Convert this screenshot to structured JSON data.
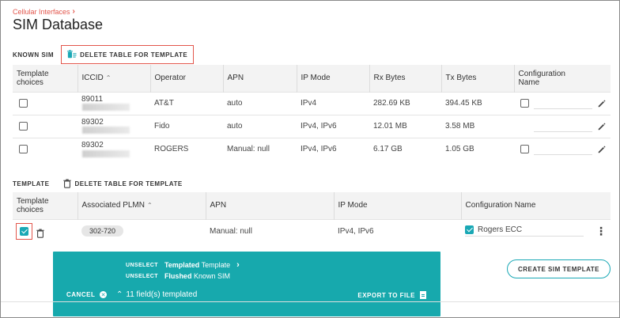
{
  "breadcrumb": {
    "item": "Cellular Interfaces",
    "chevron": "›"
  },
  "page_title": "SIM Database",
  "known_sim": {
    "label": "KNOWN SIM",
    "delete_label": "DELETE TABLE FOR TEMPLATE",
    "headers": {
      "template_choices_1": "Template",
      "template_choices_2": "choices",
      "iccid": "ICCID",
      "operator": "Operator",
      "apn": "APN",
      "ip_mode": "IP Mode",
      "rx": "Rx Bytes",
      "tx": "Tx Bytes",
      "config_1": "Configuration",
      "config_2": "Name"
    },
    "rows": [
      {
        "iccid": "89011",
        "operator": "AT&T",
        "apn": "auto",
        "ip_mode": "IPv4",
        "rx": "282.69 KB",
        "tx": "394.45 KB"
      },
      {
        "iccid": "89302",
        "operator": "Fido",
        "apn": "auto",
        "ip_mode": "IPv4, IPv6",
        "rx": "12.01 MB",
        "tx": "3.58 MB"
      },
      {
        "iccid": "89302",
        "operator": "ROGERS",
        "apn": "Manual: null",
        "ip_mode": "IPv4, IPv6",
        "rx": "6.17 GB",
        "tx": "1.05 GB"
      }
    ]
  },
  "template": {
    "label": "TEMPLATE",
    "delete_label": "DELETE TABLE FOR TEMPLATE",
    "headers": {
      "template_choices_1": "Template",
      "template_choices_2": "choices",
      "plmn": "Associated PLMN",
      "apn": "APN",
      "ip_mode": "IP Mode",
      "config": "Configuration Name"
    },
    "row": {
      "plmn": "302-720",
      "apn": "Manual: null",
      "ip_mode": "IPv4, IPv6",
      "config": "Rogers ECC"
    }
  },
  "snackbar": {
    "unselect": "UNSELECT",
    "line1_bold": "Templated",
    "line1_rest": "Template",
    "line2_bold": "Flushed",
    "line2_rest": "Known SIM",
    "cancel": "CANCEL",
    "count": "11 field(s) templated",
    "export": "EXPORT TO FILE"
  },
  "create_button": "CREATE SIM TEMPLATE",
  "colors": {
    "accent": "#1aa8b5",
    "highlight": "#e2564c",
    "breadcrumb": "#e2564c"
  }
}
